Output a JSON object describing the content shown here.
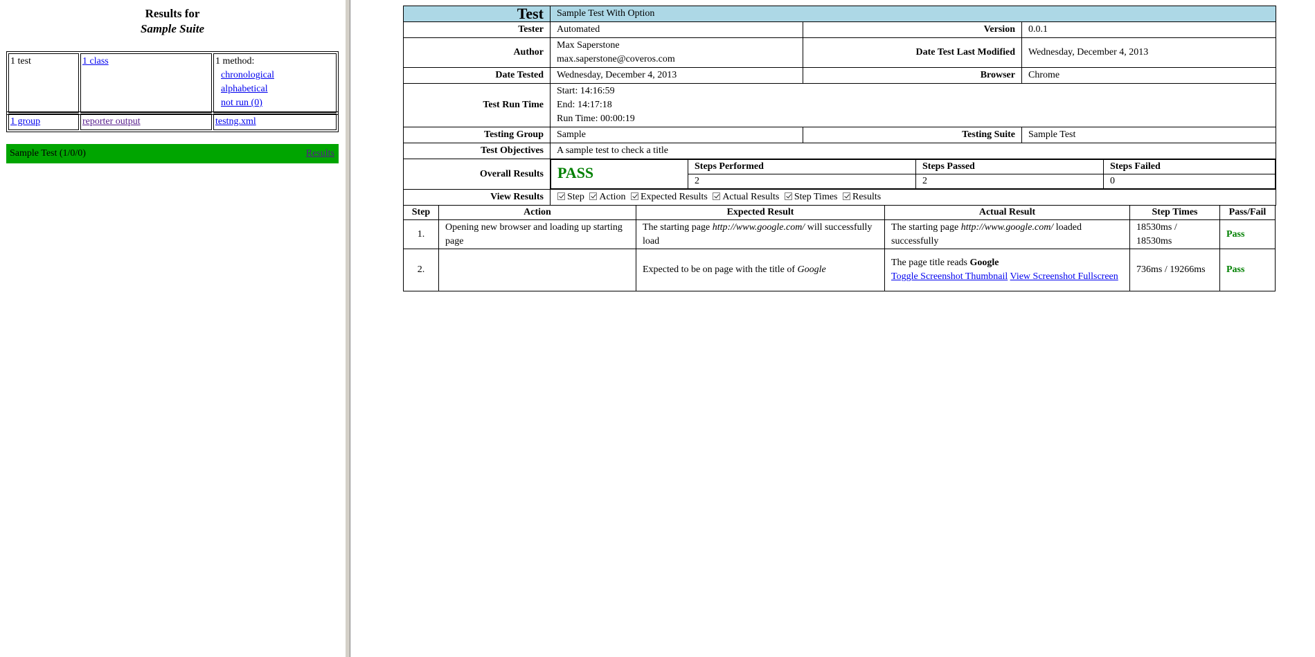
{
  "left": {
    "title_line1": "Results for",
    "title_line2": "Sample Suite",
    "summary": {
      "tests": "1 test",
      "classes": "1 class",
      "methods_label": "1 method:",
      "method_links": [
        "chronological",
        "alphabetical",
        "not run (0)"
      ],
      "groups": "1 group",
      "reporter_output": "reporter output",
      "testng_xml": "testng.xml"
    },
    "test_bar": {
      "name": "Sample Test (1/0/0)",
      "results_link": "Results",
      "color": "#00a500"
    }
  },
  "report": {
    "title_label": "Test",
    "title_value": "Sample Test With Option",
    "header_color": "#add8e6",
    "tester_label": "Tester",
    "tester": "Automated",
    "version_label": "Version",
    "version": "0.0.1",
    "author_label": "Author",
    "author_name": "Max Saperstone",
    "author_email": "max.saperstone@coveros.com",
    "last_modified_label": "Date Test Last Modified",
    "last_modified": "Wednesday, December 4, 2013",
    "date_tested_label": "Date Tested",
    "date_tested": "Wednesday, December 4, 2013",
    "browser_label": "Browser",
    "browser": "Chrome",
    "run_time_label": "Test Run Time",
    "start": "Start: 14:16:59",
    "end": "End: 14:17:18",
    "run_time": "Run Time: 00:00:19",
    "group_label": "Testing Group",
    "group": "Sample",
    "suite_label": "Testing Suite",
    "suite": "Sample Test",
    "objectives_label": "Test Objectives",
    "objectives": "A sample test to check a title",
    "overall_label": "Overall Results",
    "overall": "PASS",
    "pass_color": "#008000",
    "steps_performed_label": "Steps Performed",
    "steps_performed": "2",
    "steps_passed_label": "Steps Passed",
    "steps_passed": "2",
    "steps_failed_label": "Steps Failed",
    "steps_failed": "0",
    "view_results_label": "View Results",
    "view_toggles": [
      "Step",
      "Action",
      "Expected Results",
      "Actual Results",
      "Step Times",
      "Results"
    ]
  },
  "steps_table": {
    "headers": [
      "Step",
      "Action",
      "Expected Result",
      "Actual Result",
      "Step Times",
      "Pass/Fail"
    ],
    "rows": [
      {
        "step": "1.",
        "action": "Opening new browser and loading up starting page",
        "expected_pre": "The starting page ",
        "expected_url": "http://www.google.com/",
        "expected_post": " will successfully load",
        "actual_pre": "The starting page ",
        "actual_url": "http://www.google.com/",
        "actual_post": " loaded successfully",
        "times": "18530ms / 18530ms",
        "result": "Pass"
      },
      {
        "step": "2.",
        "action": "",
        "expected_pre": "Expected to be on page with the title of ",
        "expected_title": "Google",
        "actual_pre": "The page title reads ",
        "actual_title": "Google",
        "link_thumbnail": "Toggle Screenshot Thumbnail",
        "link_fullscreen": "View Screenshot Fullscreen",
        "times": "736ms / 19266ms",
        "result": "Pass"
      }
    ]
  }
}
